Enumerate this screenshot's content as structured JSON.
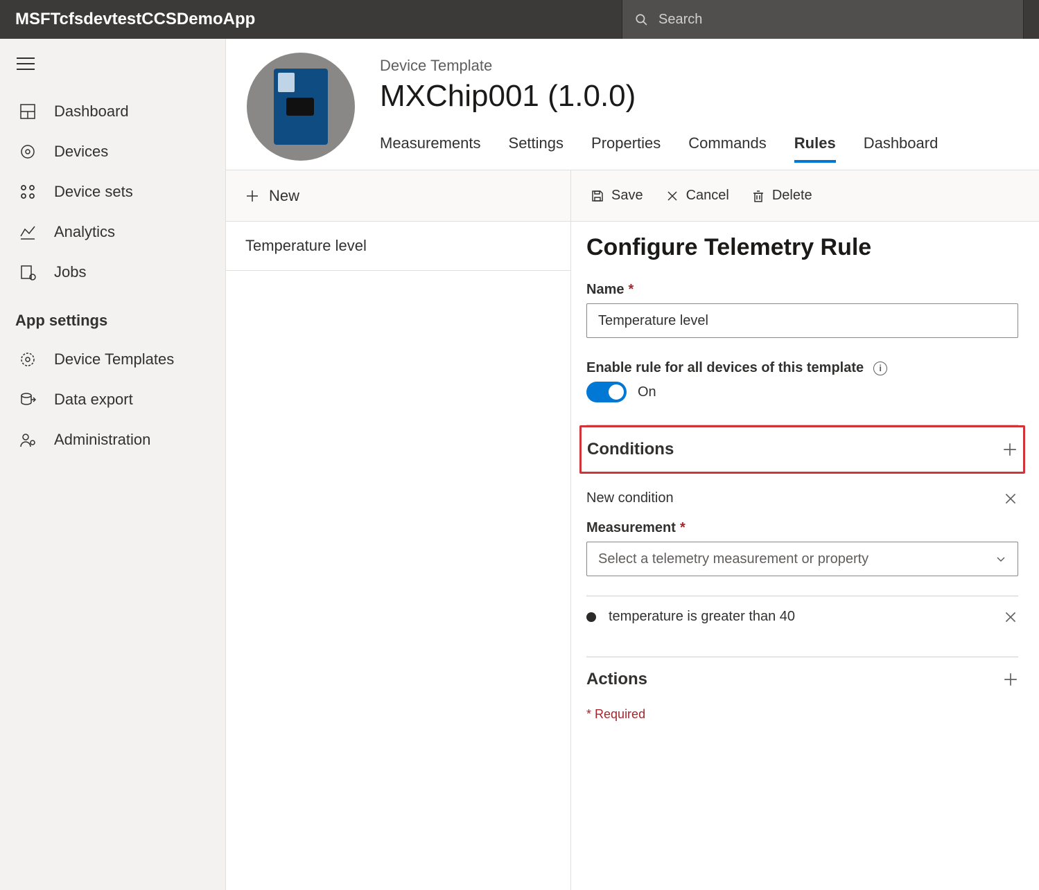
{
  "topbar": {
    "app_title": "MSFTcfsdevtestCCSDemoApp",
    "search_placeholder": "Search"
  },
  "nav": {
    "items": [
      {
        "label": "Dashboard"
      },
      {
        "label": "Devices"
      },
      {
        "label": "Device sets"
      },
      {
        "label": "Analytics"
      },
      {
        "label": "Jobs"
      }
    ],
    "section_title": "App settings",
    "settings_items": [
      {
        "label": "Device Templates"
      },
      {
        "label": "Data export"
      },
      {
        "label": "Administration"
      }
    ]
  },
  "header": {
    "overline": "Device Template",
    "title": "MXChip001  (1.0.0)",
    "tabs": [
      {
        "label": "Measurements"
      },
      {
        "label": "Settings"
      },
      {
        "label": "Properties"
      },
      {
        "label": "Commands"
      },
      {
        "label": "Rules",
        "active": true
      },
      {
        "label": "Dashboard"
      }
    ]
  },
  "rules_panel": {
    "new_label": "New",
    "rows": [
      {
        "label": "Temperature level"
      }
    ]
  },
  "detail": {
    "toolbar": {
      "save": "Save",
      "cancel": "Cancel",
      "delete": "Delete"
    },
    "title": "Configure Telemetry Rule",
    "name_label": "Name",
    "name_value": "Temperature level",
    "enable_label": "Enable rule for all devices of this template",
    "enable_state": "On",
    "conditions_title": "Conditions",
    "new_condition_label": "New condition",
    "measurement_label": "Measurement",
    "measurement_placeholder": "Select a telemetry measurement or property",
    "existing_condition": "temperature is greater than 40",
    "actions_title": "Actions",
    "required_footnote": "Required"
  }
}
